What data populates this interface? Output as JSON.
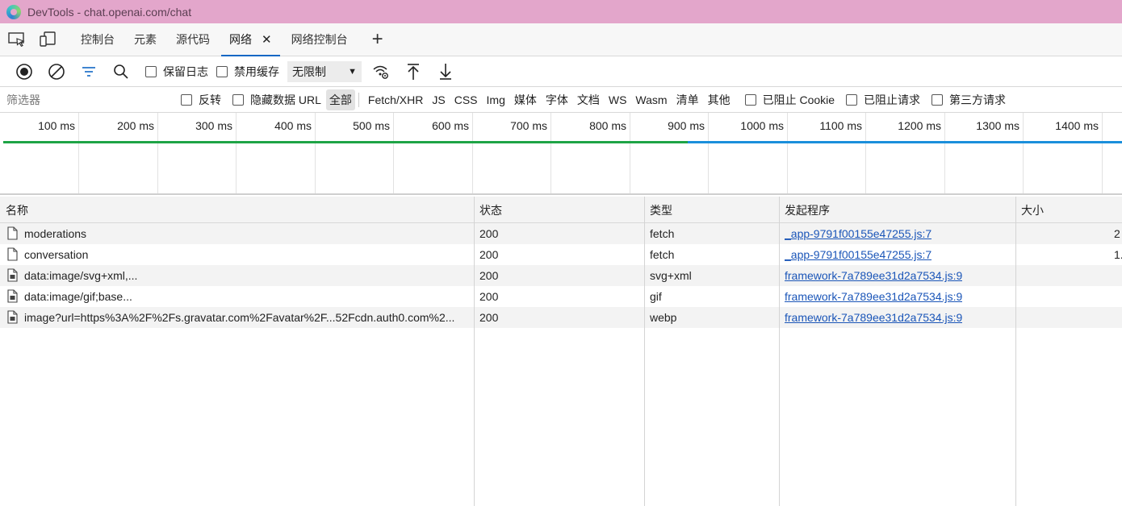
{
  "window": {
    "title": "DevTools - chat.openai.com/chat"
  },
  "tabs": [
    {
      "label": "控制台"
    },
    {
      "label": "元素"
    },
    {
      "label": "源代码"
    },
    {
      "label": "网络",
      "active": true,
      "close": "✕"
    },
    {
      "label": "网络控制台"
    }
  ],
  "tabbar": {
    "add": "+"
  },
  "toolbar": {
    "preserve_log": "保留日志",
    "disable_cache": "禁用缓存",
    "throttle": "无限制",
    "throttle_arrow": "▼"
  },
  "filterbar": {
    "placeholder": "筛选器",
    "invert": "反转",
    "hide_data_urls": "隐藏数据 URL",
    "types": [
      "全部",
      "Fetch/XHR",
      "JS",
      "CSS",
      "Img",
      "媒体",
      "字体",
      "文档",
      "WS",
      "Wasm",
      "清单",
      "其他"
    ],
    "blocked_cookies": "已阻止 Cookie",
    "blocked_requests": "已阻止请求",
    "third_party": "第三方请求"
  },
  "timeline": {
    "ticks": [
      "100 ms",
      "200 ms",
      "300 ms",
      "400 ms",
      "500 ms",
      "600 ms",
      "700 ms",
      "800 ms",
      "900 ms",
      "1000 ms",
      "1100 ms",
      "1200 ms",
      "1300 ms",
      "1400 ms"
    ]
  },
  "table": {
    "columns": [
      "名称",
      "状态",
      "类型",
      "发起程序",
      "大小"
    ],
    "rows": [
      {
        "name": "moderations",
        "status": "200",
        "type": "fetch",
        "initiator": "_app-9791f00155e47255.js:7",
        "size": "2",
        "icon": "document-icon"
      },
      {
        "name": "conversation",
        "status": "200",
        "type": "fetch",
        "initiator": "_app-9791f00155e47255.js:7",
        "size": "1.",
        "icon": "document-icon"
      },
      {
        "name": "data:image/svg+xml,...",
        "status": "200",
        "type": "svg+xml",
        "initiator": "framework-7a789ee31d2a7534.js:9",
        "size": "",
        "icon": "image-file-icon"
      },
      {
        "name": "data:image/gif;base...",
        "status": "200",
        "type": "gif",
        "initiator": "framework-7a789ee31d2a7534.js:9",
        "size": "",
        "icon": "image-file-icon"
      },
      {
        "name": "image?url=https%3A%2F%2Fs.gravatar.com%2Favatar%2F...52Fcdn.auth0.com%2...",
        "status": "200",
        "type": "webp",
        "initiator": "framework-7a789ee31d2a7534.js:9",
        "size": "",
        "icon": "image-file-icon"
      }
    ]
  },
  "colors": {
    "titlebar": "#e3a6cb",
    "accent": "#1167c4",
    "timeline_green": "#1ea446",
    "timeline_blue": "#1a8fdb",
    "link": "#1a55b8"
  }
}
